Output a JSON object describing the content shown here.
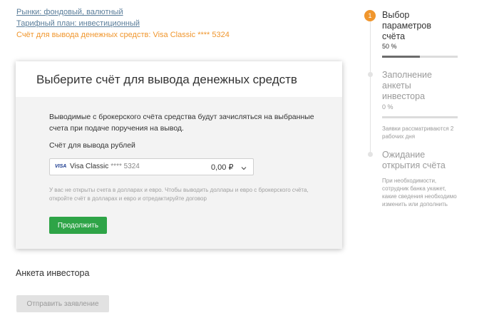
{
  "breadcrumbs": [
    {
      "label": "Рынки: фондовый, валютный"
    },
    {
      "label": "Тарифный план: инвестиционный"
    },
    {
      "label": "Счёт для вывода денежных средств: Visa Classic **** 5324"
    }
  ],
  "card": {
    "title": "Выберите счёт для вывода денежных средств",
    "description": "Выводимые с брокерского счёта средства будут зачисляться на выбранные счета при подаче поручения на вывод.",
    "account_label": "Счёт для вывода рублей",
    "selected_account": {
      "brand": "VISA",
      "name": "Visa Classic",
      "mask": "**** 5324",
      "amount": "0,00 ₽"
    },
    "note": "У вас не открыты счета в долларах и евро. Чтобы выводить доллары и евро с брокерского счёта, откройте счёт в долларах и евро и отредактируйте договор",
    "continue_label": "Продолжить"
  },
  "section": {
    "title": "Анкета инвестора",
    "submit_label": "Отправить заявление"
  },
  "stepper": [
    {
      "number": "1",
      "title": "Выбор параметров счёта",
      "percent_label": "50 %",
      "progress": 0.5,
      "state": "active"
    },
    {
      "title": "Заполнение анкеты инвестора",
      "percent_label": "0 %",
      "progress": 0,
      "hint": "Заявки рассматриваются 2 рабочих дня",
      "state": "inactive"
    },
    {
      "title": "Ожидание открытия счёта",
      "hint": "При необходимости, сотрудник банка укажет, какие сведения необходимо изменить или дополнить",
      "state": "inactive"
    }
  ],
  "colors": {
    "accent_orange": "#f0962d",
    "button_green": "#2ea447",
    "link": "#5a7d9a"
  }
}
